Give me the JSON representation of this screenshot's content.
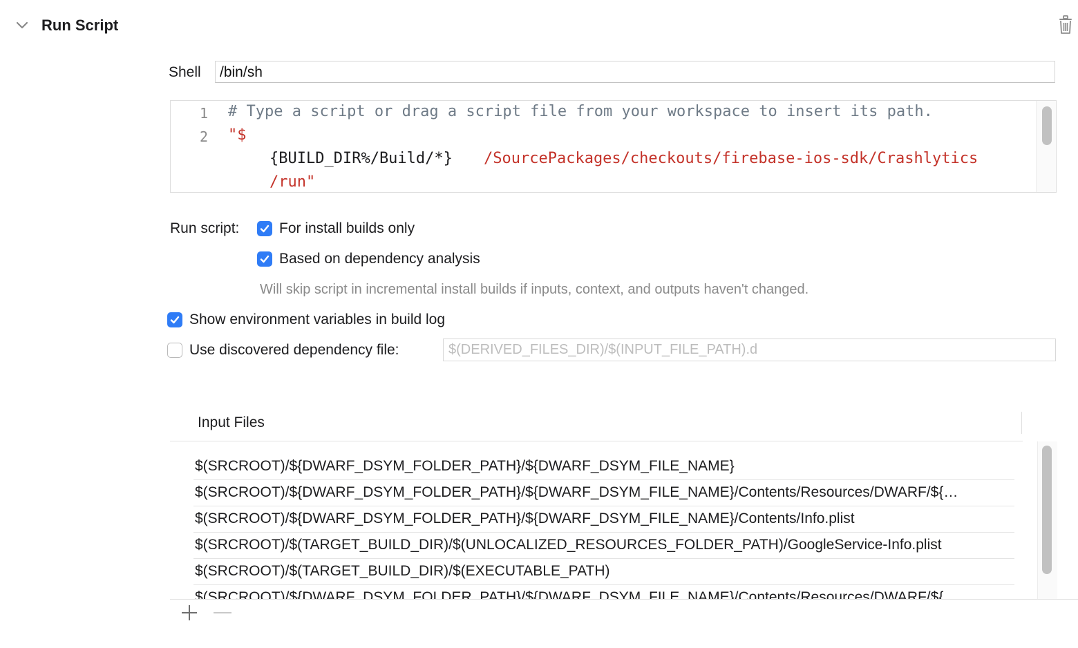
{
  "phase": {
    "title": "Run Script"
  },
  "shell": {
    "label": "Shell",
    "value": "/bin/sh"
  },
  "script": {
    "lines": [
      {
        "number": "1",
        "text": "# Type a script or drag a script file from your workspace to insert its path."
      },
      {
        "number": "2",
        "text_start": "\"$",
        "text_var": "{BUILD_DIR%/Build/*}",
        "text_path": "/SourcePackages/checkouts/firebase-ios-sdk/Crashlytics",
        "text_end": "/run\""
      }
    ]
  },
  "options": {
    "run_script_label": "Run script:",
    "install_builds_only": {
      "label": "For install builds only",
      "checked": true
    },
    "dependency_analysis": {
      "label": "Based on dependency analysis",
      "checked": true
    },
    "dependency_note": "Will skip script in incremental install builds if inputs, context, and outputs haven't changed.",
    "show_env_vars": {
      "label": "Show environment variables in build log",
      "checked": true
    },
    "use_dep_file": {
      "label": "Use discovered dependency file:",
      "checked": false,
      "placeholder": "$(DERIVED_FILES_DIR)/$(INPUT_FILE_PATH).d"
    }
  },
  "input_files": {
    "header": "Input Files",
    "rows": [
      "$(SRCROOT)/${DWARF_DSYM_FOLDER_PATH}/${DWARF_DSYM_FILE_NAME}",
      "$(SRCROOT)/${DWARF_DSYM_FOLDER_PATH}/${DWARF_DSYM_FILE_NAME}/Contents/Resources/DWARF/${…",
      "$(SRCROOT)/${DWARF_DSYM_FOLDER_PATH}/${DWARF_DSYM_FILE_NAME}/Contents/Info.plist",
      "$(SRCROOT)/$(TARGET_BUILD_DIR)/$(UNLOCALIZED_RESOURCES_FOLDER_PATH)/GoogleService-Info.plist",
      "$(SRCROOT)/$(TARGET_BUILD_DIR)/$(EXECUTABLE_PATH)",
      "$(SRCROOT)/${DWARF_DSYM_FOLDER_PATH}/${DWARF_DSYM_FILE_NAME}/Contents/Resources/DWARF/${…"
    ]
  },
  "icons": {
    "collapse": "chevron-down-icon",
    "delete": "trash-icon",
    "add": "plus-icon",
    "remove": "minus-icon",
    "checkbox_checked": "checkmark-icon"
  },
  "colors": {
    "accent": "#2f7cf6",
    "string": "#c4332a",
    "comment": "#6f7b87"
  }
}
